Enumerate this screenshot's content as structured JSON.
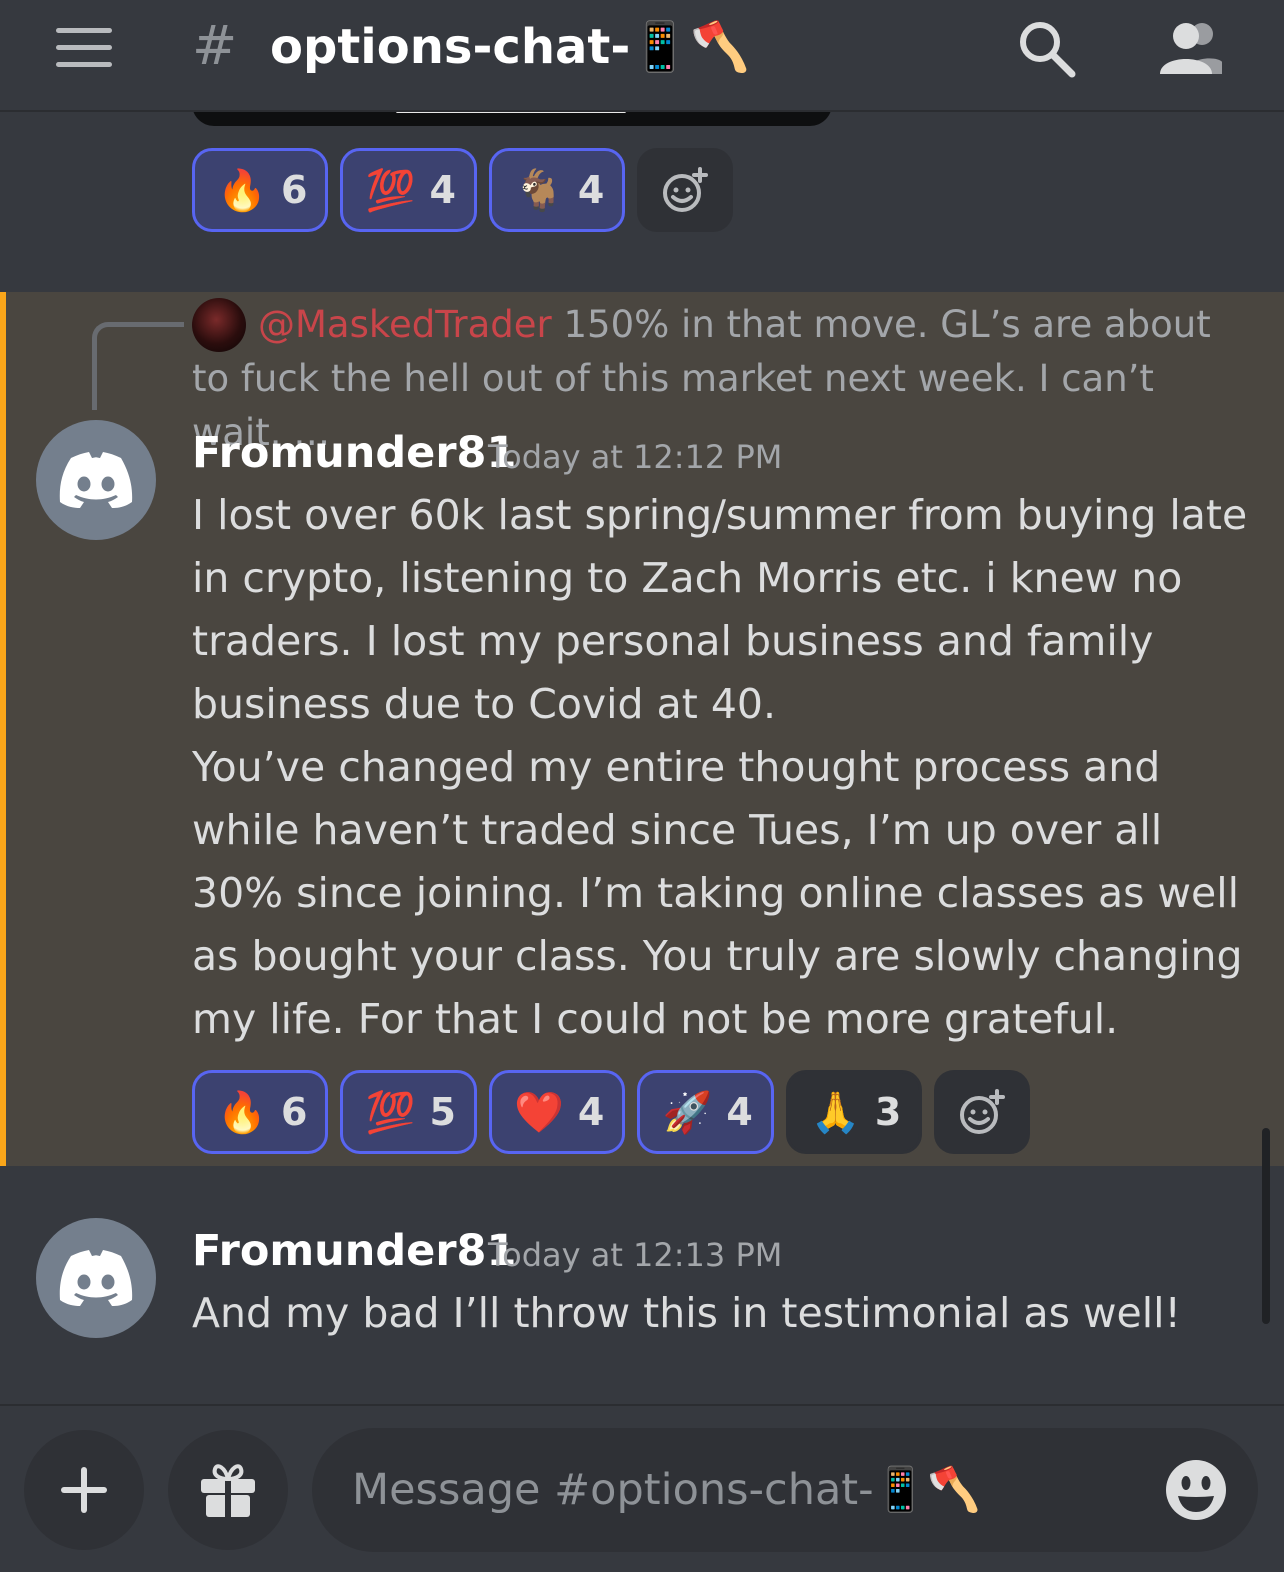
{
  "header": {
    "hash_symbol": "#",
    "channel_name": "options-chat-📱🪓"
  },
  "top_reactions": [
    {
      "emoji": "🔥",
      "count": "6",
      "active": true
    },
    {
      "emoji": "💯",
      "count": "4",
      "active": true
    },
    {
      "emoji": "🐐",
      "count": "4",
      "active": true
    }
  ],
  "highlighted_message": {
    "reply": {
      "mention": "@MaskedTrader",
      "text": " 150% in that move. GL’s are about to fuck the hell out of this market next week. I can’t wait. …"
    },
    "author": "Fromunder81",
    "timestamp": "Today at 12:12 PM",
    "body": "I lost over 60k last spring/summer from buying late in crypto, listening to Zach Morris etc. i knew no traders. I lost my personal business and family business due to Covid at 40.\nYou’ve changed my entire thought process and while haven’t traded since Tues, I’m up over all 30% since joining. I’m taking online classes as well as bought your class. You truly are slowly changing my life. For that I could not be more grateful.",
    "reactions": [
      {
        "emoji": "🔥",
        "count": "6",
        "active": true
      },
      {
        "emoji": "💯",
        "count": "5",
        "active": true
      },
      {
        "emoji": "❤️",
        "count": "4",
        "active": true
      },
      {
        "emoji": "🚀",
        "count": "4",
        "active": true
      },
      {
        "emoji": "🙏",
        "count": "3",
        "active": false
      }
    ]
  },
  "second_message": {
    "author": "Fromunder81",
    "timestamp": "Today at 12:13 PM",
    "body": "And my bad I’ll throw this in testimonial as well!"
  },
  "composer": {
    "placeholder": "Message #options-chat-📱🪓"
  },
  "colors": {
    "accent": "#5865f2",
    "highlight_bar": "#faa61a",
    "mention": "#c9454a"
  }
}
